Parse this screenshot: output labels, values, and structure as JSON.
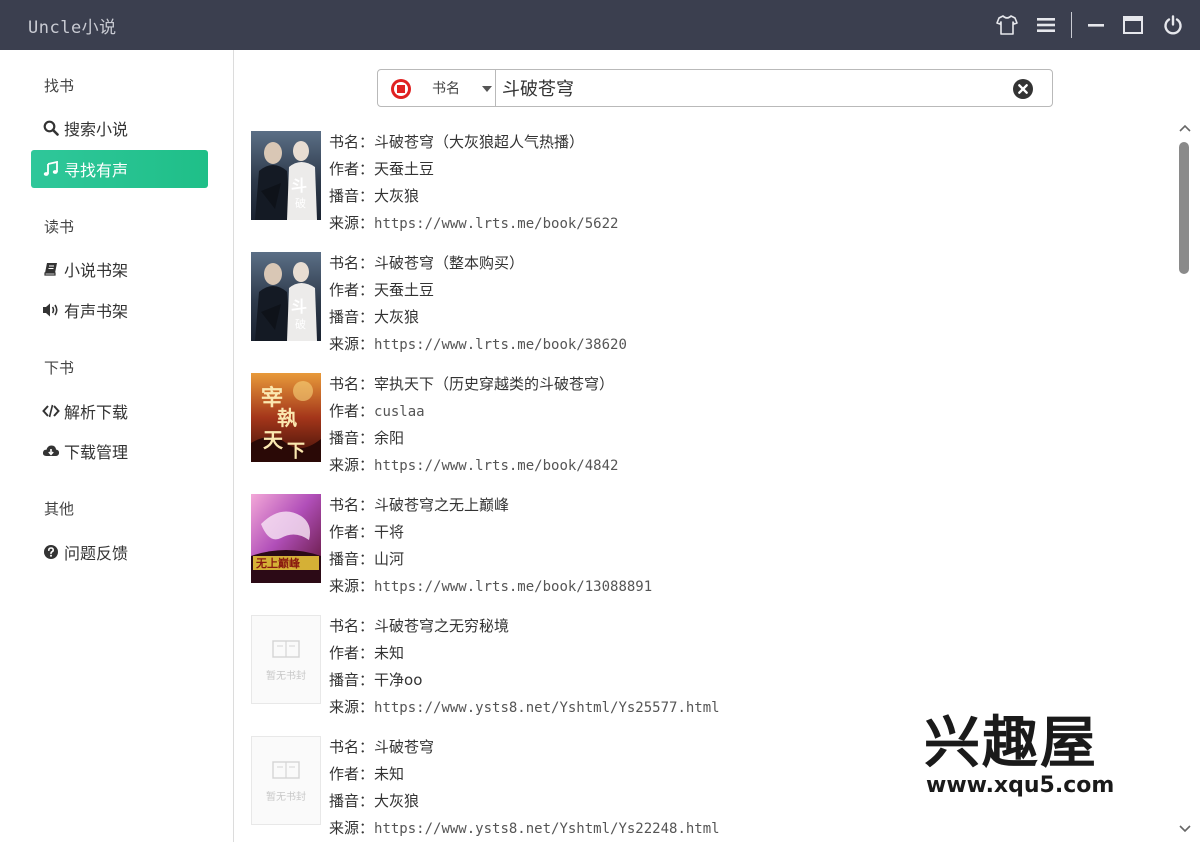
{
  "app": {
    "title": "Uncle小说"
  },
  "titlebar": {
    "icons": [
      "shirt-icon",
      "menu-icon",
      "minimize-icon",
      "maximize-icon",
      "power-icon"
    ]
  },
  "sidebar": {
    "sections": [
      {
        "title": "找书",
        "items": [
          {
            "label": "搜索小说",
            "icon": "search-icon"
          },
          {
            "label": "寻找有声",
            "icon": "music-icon",
            "active": true
          }
        ]
      },
      {
        "title": "读书",
        "items": [
          {
            "label": "小说书架",
            "icon": "book-icon"
          },
          {
            "label": "有声书架",
            "icon": "volume-icon"
          }
        ]
      },
      {
        "title": "下书",
        "items": [
          {
            "label": "解析下载",
            "icon": "code-icon"
          },
          {
            "label": "下载管理",
            "icon": "cloud-download-icon"
          }
        ]
      },
      {
        "title": "其他",
        "items": [
          {
            "label": "问题反馈",
            "icon": "question-icon"
          }
        ]
      }
    ]
  },
  "search": {
    "type_label": "书名",
    "value": "斗破苍穹"
  },
  "labels": {
    "title": "书名：",
    "author": "作者：",
    "narrator": "播音：",
    "source": "来源："
  },
  "results": [
    {
      "title": "斗破苍穹（大灰狼超人气热播）",
      "author": "天蚕土豆",
      "narrator": "大灰狼",
      "source": "https://www.lrts.me/book/5622"
    },
    {
      "title": "斗破苍穹（整本购买）",
      "author": "天蚕土豆",
      "narrator": "大灰狼",
      "source": "https://www.lrts.me/book/38620"
    },
    {
      "title": "宰执天下（历史穿越类的斗破苍穹）",
      "author": "cuslaa",
      "narrator": "余阳",
      "source": "https://www.lrts.me/book/4842"
    },
    {
      "title": "斗破苍穹之无上巅峰",
      "author": "干将",
      "narrator": "山河",
      "source": "https://www.lrts.me/book/13088891"
    },
    {
      "title": "斗破苍穹之无穷秘境",
      "author": "未知",
      "narrator": "干净oo",
      "source": "https://www.ysts8.net/Yshtml/Ys25577.html",
      "cover_text": "暂无书封"
    },
    {
      "title": "斗破苍穹",
      "author": "未知",
      "narrator": "大灰狼",
      "source": "https://www.ysts8.net/Yshtml/Ys22248.html",
      "cover_text": "暂无书封"
    }
  ],
  "watermark": {
    "text": "兴趣屋",
    "url": "www.xqu5.com"
  },
  "colors": {
    "titlebar": "#3b3f4f",
    "accent": "#21c08b",
    "stop": "#e02020"
  }
}
